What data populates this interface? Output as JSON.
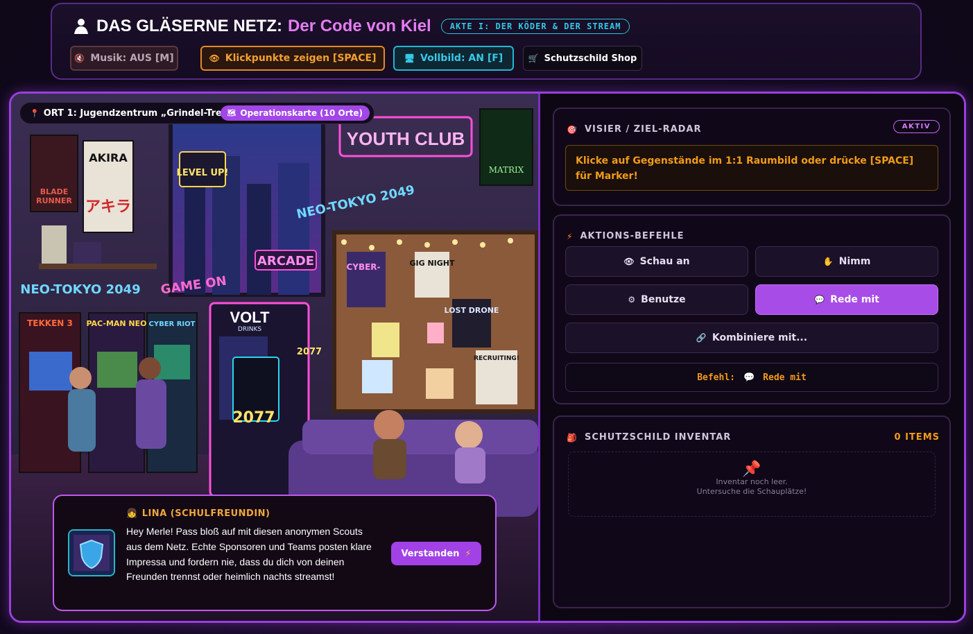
{
  "header": {
    "title_main": "DAS GLÄSERNE NETZ:",
    "title_sub": "Der Code von Kiel",
    "act_badge": "AKTE I: DER KÖDER & DER STREAM",
    "buttons": {
      "music": "Musik: AUS [M]",
      "hotspots": "Klickpunkte zeigen [SPACE]",
      "fullscreen": "Vollbild: AN [F]",
      "shop": "Schutzschild Shop"
    }
  },
  "scene": {
    "location": "ORT 1: Jugendzentrum „Grindel-Tref...",
    "map_button": "Operationskarte (10 Orte)",
    "signs": {
      "youth_club": "YOUTH CLUB",
      "akira": "AKIRA",
      "akira_jp": "アキラ",
      "blade": "BLADE",
      "runner": "RUNNER",
      "level_up": "LEVEL UP!",
      "arcade": "ARCADE",
      "neo_tokyo": "NEO-TOKYO 2049",
      "matrix": "MATRIX",
      "volt": "VOLT",
      "drinks": "DRINKS",
      "gig_night": "GIG NIGHT",
      "lost_drone": "LOST DRONE",
      "recruiting": "RECRUITING!",
      "cyber": "CYBER-",
      "tekken": "TEKKEN 3",
      "pacman": "PAC-MAN NEO",
      "cyber_riot": "CYBER RIOT",
      "game_on": "GAME ON",
      "year": "2077"
    }
  },
  "dialog": {
    "speaker": "LINA (SCHULFREUNDIN)",
    "text": "Hey Merle! Pass bloß auf mit diesen anonymen Scouts aus dem Netz. Echte Sponsoren und Teams posten klare Impressa und fordern nie, dass du dich von deinen Freunden trennst oder heimlich nachts streamst!",
    "ok_button": "Verstanden"
  },
  "visier": {
    "title": "VISIER / ZIEL-RADAR",
    "status": "AKTIV",
    "message": "Klicke auf Gegenstände im 1:1 Raumbild oder drücke [SPACE] für Marker!"
  },
  "actions": {
    "title": "AKTIONS-BEFEHLE",
    "look": "Schau an",
    "take": "Nimm",
    "use": "Benutze",
    "talk": "Rede mit",
    "combine": "Kombiniere mit...",
    "command_label": "Befehl:",
    "command_value": "Rede mit"
  },
  "inventory": {
    "title": "SCHUTZSCHILD INVENTAR",
    "count": "0 ITEMS",
    "empty_line1": "Inventar noch leer.",
    "empty_line2": "Untersuche die Schauplätze!"
  },
  "colors": {
    "accent_purple": "#a246e8",
    "accent_orange": "#f29b1a",
    "accent_cyan": "#29c3e0"
  }
}
